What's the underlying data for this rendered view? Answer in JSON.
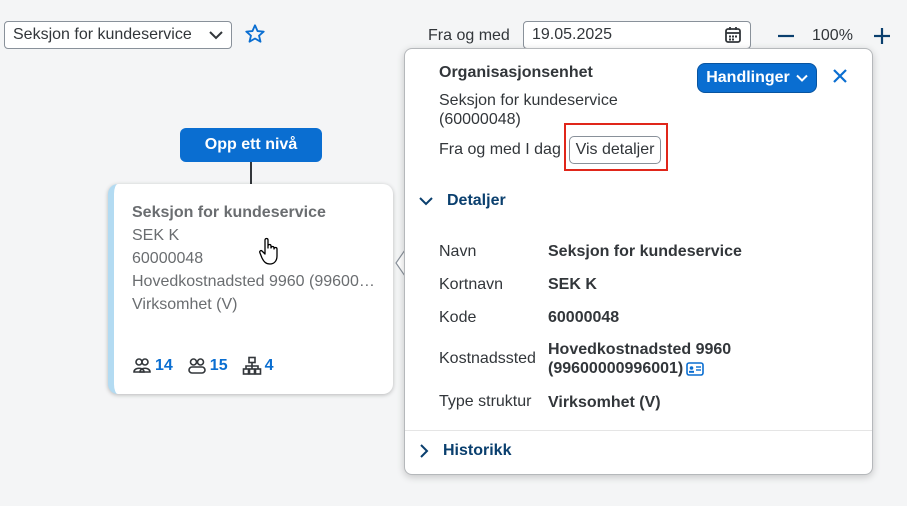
{
  "toolbar": {
    "unit_select_value": "Seksjon for kundeservice",
    "date_label": "Fra og med",
    "date_value": "19.05.2025",
    "zoom_value": "100%"
  },
  "chart": {
    "up_button": "Opp ett nivå",
    "card": {
      "title": "Seksjon for kundeservice",
      "short_name": "SEK K",
      "code": "60000048",
      "cost_center": "Hovedkostnadsted 9960 (99600…",
      "type": "Virksomhet (V)",
      "counts": {
        "people": "14",
        "positions": "15",
        "units": "4"
      }
    }
  },
  "popover": {
    "title": "Organisasjonsenhet",
    "name_line1": "Seksjon for kundeservice",
    "name_line2": "(60000048)",
    "date_text": "Fra og med I dag",
    "details_button": "Vis detaljer",
    "actions_button": "Handlinger",
    "details_section": "Detaljer",
    "history_section": "Historikk",
    "fields": {
      "navn_label": "Navn",
      "navn_value": "Seksjon for kundeservice",
      "kortnavn_label": "Kortnavn",
      "kortnavn_value": "SEK K",
      "kode_label": "Kode",
      "kode_value": "60000048",
      "kostnadssted_label": "Kostnadssted",
      "kostnadssted_value1": "Hovedkostnadsted 9960",
      "kostnadssted_value2": "(99600000996001)",
      "type_label": "Type struktur",
      "type_value": "Virksomhet (V)"
    }
  },
  "colors": {
    "accent": "#0a6ed1",
    "highlight": "#e0261a",
    "card_stripe": "#b3dbf2"
  }
}
